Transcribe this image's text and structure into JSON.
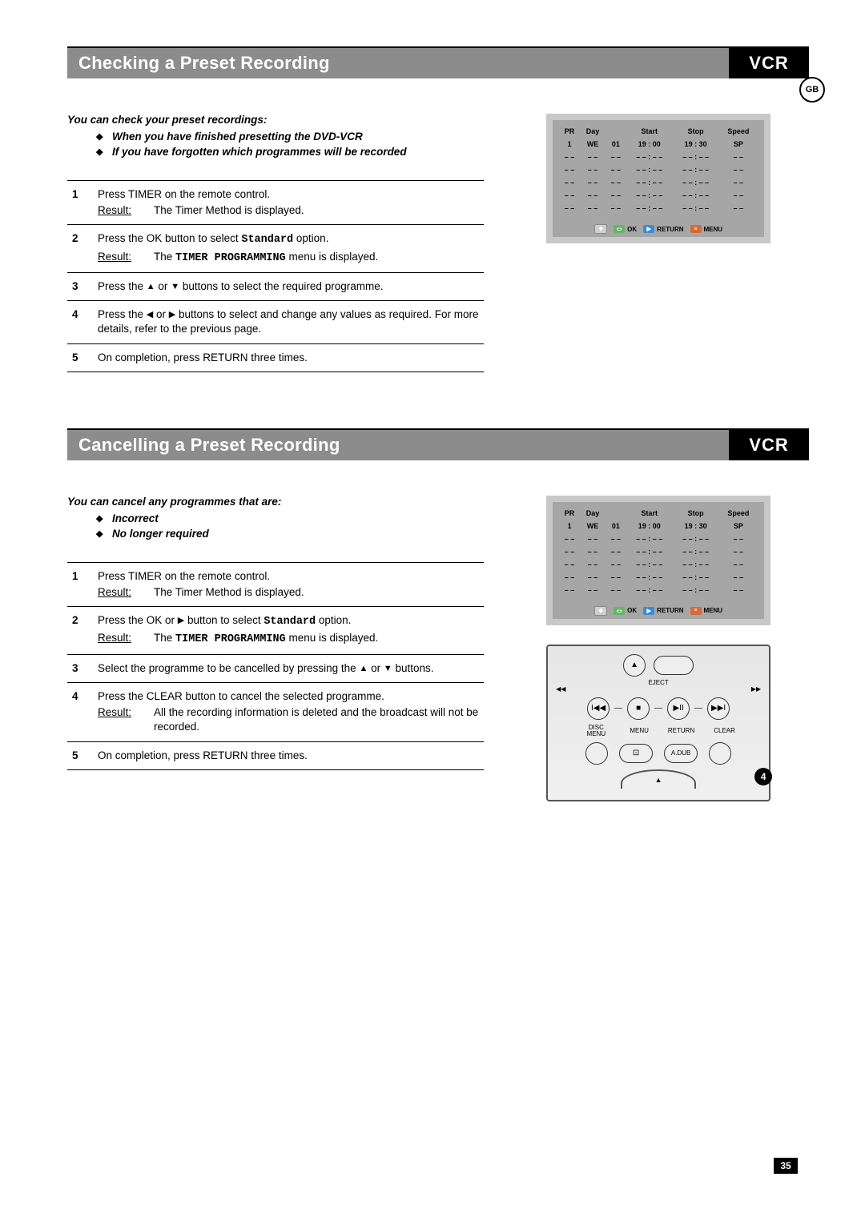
{
  "lang_badge": "GB",
  "page_number": "35",
  "section1": {
    "title": "Checking a Preset Recording",
    "vcr": "VCR",
    "intro": "You can check your preset recordings:",
    "bullets": [
      "When you have finished presetting the DVD-VCR",
      "If you have forgotten which programmes will be recorded"
    ],
    "steps": [
      {
        "text": "Press TIMER on the remote control.",
        "result_label": "Result:",
        "result_text": "The Timer Method is displayed."
      },
      {
        "text_html": "Press the OK button to select <span class='mono'>Standard</span>  option.",
        "result_label": "Result:",
        "result_html": "The <span class='mono'>TIMER PROGRAMMING</span> menu is displayed."
      },
      {
        "text_html": "Press the <span class='arrow'>▲</span> or <span class='arrow'>▼</span> buttons to select the required programme."
      },
      {
        "text_html": "Press the <span class='arrow'>◀</span> or <span class='arrow'>▶</span> buttons to select and change any values as required. For more details, refer to the previous page."
      },
      {
        "text": "On completion, press RETURN three times."
      }
    ]
  },
  "section2": {
    "title": "Cancelling a Preset Recording",
    "vcr": "VCR",
    "intro": "You can cancel any programmes that are:",
    "bullets": [
      "Incorrect",
      "No longer required"
    ],
    "steps": [
      {
        "text": "Press TIMER on the remote control.",
        "result_label": "Result:",
        "result_text": "The Timer Method is displayed."
      },
      {
        "text_html": "Press the OK or <span class='arrow'>▶</span> button to select <span class='mono'>Standard</span>  option.",
        "result_label": "Result:",
        "result_html": "The <span class='mono'>TIMER PROGRAMMING</span> menu is displayed."
      },
      {
        "text_html": "Select the programme to be cancelled by pressing the <span class='arrow'>▲</span> or <span class='arrow'>▼</span> buttons."
      },
      {
        "text": "Press the CLEAR button to cancel the selected programme.",
        "result_label": "Result:",
        "result_text": "All the recording information is deleted and the broadcast will not be recorded."
      },
      {
        "text": "On completion, press RETURN three times."
      }
    ]
  },
  "osd": {
    "headers": [
      "PR",
      "Day",
      "",
      "Start",
      "Stop",
      "Speed"
    ],
    "rows": [
      [
        "1",
        "WE",
        "01",
        "19 : 00",
        "19 : 30",
        "SP"
      ],
      [
        "– –",
        "– –",
        "– –",
        "– – : – –",
        "– – : – –",
        "– –"
      ],
      [
        "– –",
        "– –",
        "– –",
        "– – : – –",
        "– – : – –",
        "– –"
      ],
      [
        "– –",
        "– –",
        "– –",
        "– – : – –",
        "– – : – –",
        "– –"
      ],
      [
        "– –",
        "– –",
        "– –",
        "– – : – –",
        "– – : – –",
        "– –"
      ],
      [
        "– –",
        "– –",
        "– –",
        "– – : – –",
        "– – : – –",
        "– –"
      ]
    ],
    "footer": {
      "ok": "OK",
      "return": "RETURN",
      "menu": "MENU"
    }
  },
  "remote": {
    "eject": "EJECT",
    "rew": "◀◀",
    "prev": "I◀◀",
    "stop": "■",
    "play": "▶II",
    "next": "▶▶I",
    "ff": "▶▶",
    "disc_menu": "DISC MENU",
    "menu": "MENU",
    "return": "RETURN",
    "clear": "CLEAR",
    "adub": "A.DUB",
    "callout": "4"
  }
}
